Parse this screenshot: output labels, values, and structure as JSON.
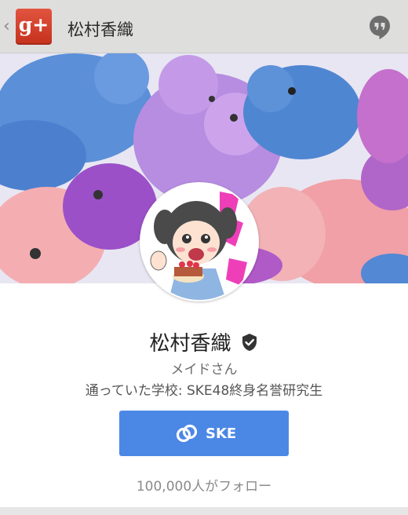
{
  "header": {
    "back_glyph": "‹",
    "app_logo_text": "g+",
    "title": "松村香織",
    "hangouts_icon": "hangouts-icon"
  },
  "colors": {
    "header_bg": "#dededd",
    "gplus_red": "#d6412c",
    "button_blue": "#4b87e5"
  },
  "profile": {
    "name": "松村香織",
    "verified_icon": "verified-badge-icon",
    "occupation": "メイドさん",
    "education": "通っていた学校: SKE48終身名誉研究生",
    "link_button": {
      "icon": "link-icon",
      "label": "SKE"
    },
    "followers": "100,000人がフォロー"
  }
}
